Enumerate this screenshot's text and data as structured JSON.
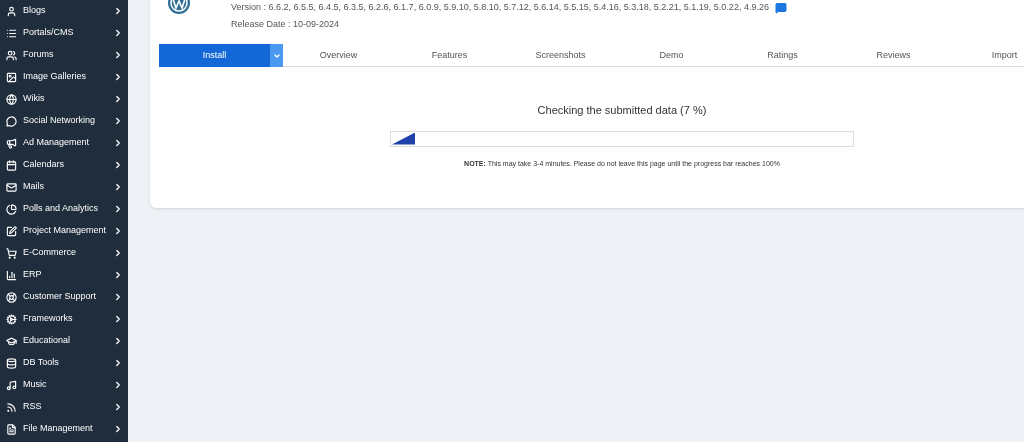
{
  "sidebar": {
    "items": [
      {
        "label": "Blogs"
      },
      {
        "label": "Portals/CMS"
      },
      {
        "label": "Forums"
      },
      {
        "label": "Image Galleries"
      },
      {
        "label": "Wikis"
      },
      {
        "label": "Social Networking"
      },
      {
        "label": "Ad Management"
      },
      {
        "label": "Calendars"
      },
      {
        "label": "Mails"
      },
      {
        "label": "Polls and Analytics"
      },
      {
        "label": "Project Management"
      },
      {
        "label": "E-Commerce"
      },
      {
        "label": "ERP"
      },
      {
        "label": "Customer Support"
      },
      {
        "label": "Frameworks"
      },
      {
        "label": "Educational"
      },
      {
        "label": "DB Tools"
      },
      {
        "label": "Music"
      },
      {
        "label": "RSS"
      },
      {
        "label": "File Management"
      }
    ]
  },
  "app": {
    "version": "Version : 6.6.2, 6.5.5, 6.4.5, 6.3.5, 6.2.6, 6.1.7, 6.0.9, 5.9.10, 5.8.10, 5.7.12, 5.6.14, 5.5.15, 5.4.16, 5.3.18, 5.2.21, 5.1.19, 5.0.22, 4.9.26",
    "release_date": "Release Date : 10-09-2024"
  },
  "tabs": [
    {
      "label": "Install",
      "kind": "install",
      "selected": true
    },
    {
      "label": "Overview",
      "kind": "tab",
      "selected": false
    },
    {
      "label": "Features",
      "kind": "tab",
      "selected": false
    },
    {
      "label": "Screenshots",
      "kind": "tab",
      "selected": false
    },
    {
      "label": "Demo",
      "kind": "tab",
      "selected": false
    },
    {
      "label": "Ratings",
      "kind": "tab",
      "selected": false
    },
    {
      "label": "Reviews",
      "kind": "tab",
      "selected": false
    },
    {
      "label": "Import",
      "kind": "tab",
      "selected": false
    }
  ],
  "progress": {
    "title": "Checking the submitted data (7 %)",
    "level": 0.05,
    "note": "**NOTE:** This may take 3-4 minutes. Please do not leave this page until the progress bar reaches 100%"
  }
}
